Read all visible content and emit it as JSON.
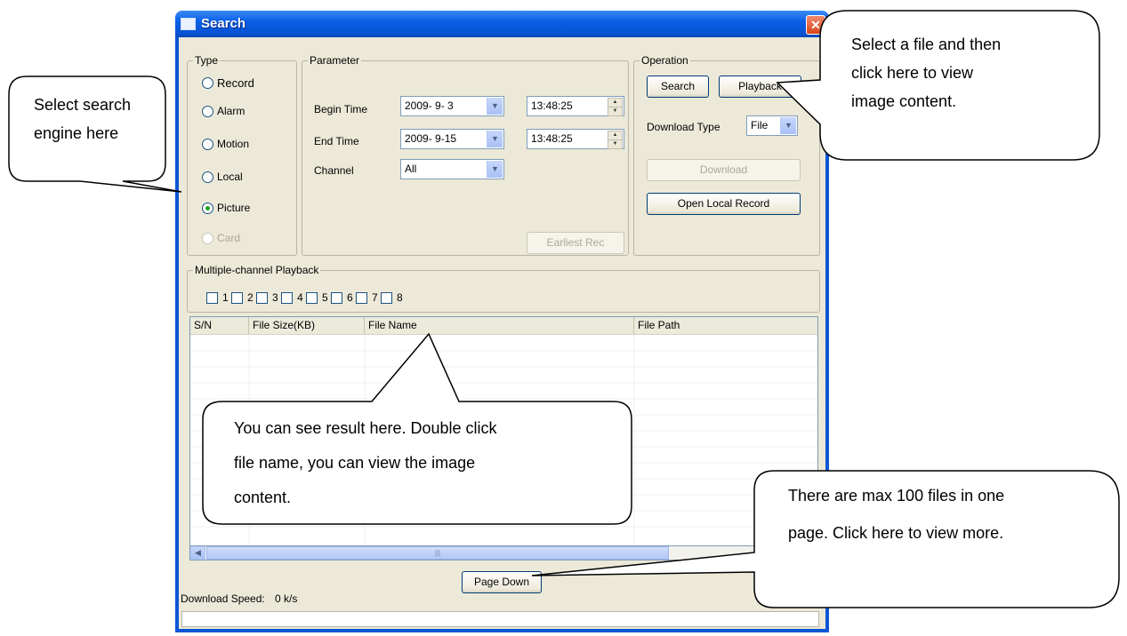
{
  "window": {
    "title": "Search",
    "close_icon": "close-icon"
  },
  "type_group": {
    "legend": "Type",
    "options": [
      {
        "label": "Record",
        "checked": false,
        "disabled": false
      },
      {
        "label": "Alarm",
        "checked": false,
        "disabled": false
      },
      {
        "label": "Motion",
        "checked": false,
        "disabled": false
      },
      {
        "label": "Local",
        "checked": false,
        "disabled": false
      },
      {
        "label": "Picture",
        "checked": true,
        "disabled": false
      },
      {
        "label": "Card",
        "checked": false,
        "disabled": true
      }
    ]
  },
  "parameter_group": {
    "legend": "Parameter",
    "begin_label": "Begin Time",
    "begin_date": "2009- 9- 3",
    "begin_time": "13:48:25",
    "end_label": "End Time",
    "end_date": "2009- 9-15",
    "end_time": "13:48:25",
    "channel_label": "Channel",
    "channel_value": "All",
    "earliest_button": "Earliest Rec"
  },
  "operation_group": {
    "legend": "Operation",
    "search_button": "Search",
    "playback_button": "Playback",
    "download_type_label": "Download Type",
    "download_type_value": "File",
    "download_button": "Download",
    "open_local_button": "Open Local Record"
  },
  "multi_playback": {
    "legend": "Multiple-channel Playback",
    "channels": [
      "1",
      "2",
      "3",
      "4",
      "5",
      "6",
      "7",
      "8"
    ]
  },
  "results_table": {
    "columns": [
      "S/N",
      "File Size(KB)",
      "File Name",
      "File Path"
    ],
    "rows": []
  },
  "page_down_button": "Page Down",
  "download_speed": {
    "label": "Download Speed:",
    "value": "0 k/s"
  },
  "callouts": {
    "search_engine": [
      "Select search",
      "engine here"
    ],
    "playback": [
      "Select a file and then",
      "click here to view",
      "image content."
    ],
    "results": [
      "You can see result here. Double click",
      "file name, you can view the image",
      "content."
    ],
    "page_down": [
      "There are max 100 files in one",
      "page. Click here to view more."
    ]
  }
}
